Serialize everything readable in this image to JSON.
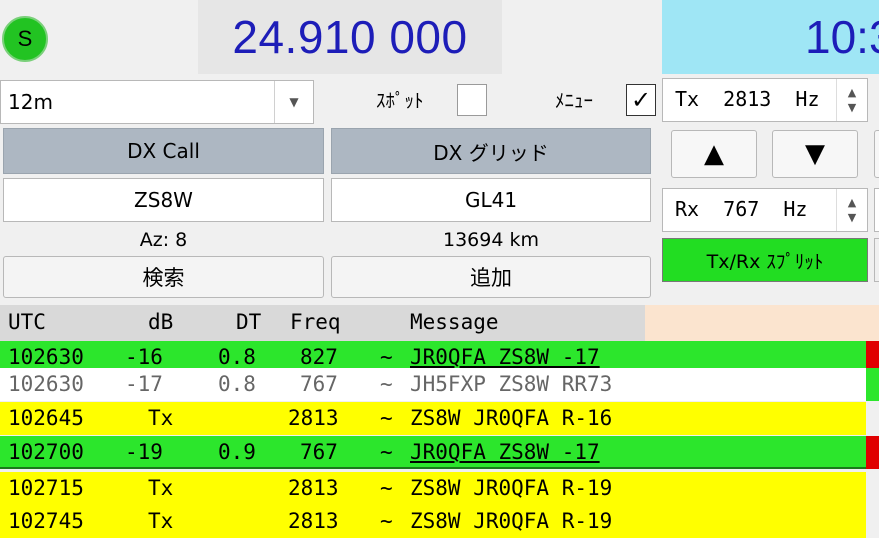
{
  "status_led": {
    "label": "S",
    "color": "#22c322"
  },
  "frequency": "24.910 000",
  "clock": "10:3",
  "band": {
    "value": "12m"
  },
  "spot": {
    "label": "ｽﾎﾟｯﾄ",
    "checked": false
  },
  "menu": {
    "label": "ﾒﾆｭｰ",
    "checked": true,
    "check_glyph": "✓"
  },
  "tx": {
    "text": "Tx  2813  Hz"
  },
  "rx": {
    "text": "Rx  767  Hz"
  },
  "arrows": {
    "up": "▲",
    "down": "▼",
    "spin_up": "▲",
    "spin_down": "▼",
    "combo": "▼"
  },
  "split_button": {
    "label": "Tx/Rx ｽﾌﾟﾘｯﾄ",
    "color": "#22dd22"
  },
  "dx": {
    "call_header": "DX Call",
    "grid_header": "DX グリッド",
    "call_value": "ZS8W",
    "grid_value": "GL41",
    "azimuth": "Az: 8",
    "distance": "13694 km",
    "search_button": "検索",
    "add_button": "追加"
  },
  "decode_columns": {
    "utc": "UTC",
    "db": "dB",
    "dt": "DT",
    "freq": "Freq",
    "message": "Message"
  },
  "decodes": [
    {
      "utc": "102630",
      "db": "-16",
      "dt": "0.8",
      "freq": "827",
      "sep": "~",
      "message": "JR0QFA ZS8W -17",
      "style": "green"
    },
    {
      "utc": "102630",
      "db": "-17",
      "dt": "0.8",
      "freq": "767",
      "sep": "~",
      "message": "JH5FXP ZS8W RR73",
      "style": "white"
    },
    {
      "utc": "102645",
      "db": "Tx",
      "dt": "",
      "freq": "2813",
      "sep": "~",
      "message": "ZS8W JR0QFA R-16",
      "style": "yellow"
    },
    {
      "utc": "102700",
      "db": "-19",
      "dt": "0.9",
      "freq": "767",
      "sep": "~",
      "message": "JR0QFA ZS8W -17",
      "style": "green"
    },
    {
      "utc": "102715",
      "db": "Tx",
      "dt": "",
      "freq": "2813",
      "sep": "~",
      "message": "ZS8W JR0QFA R-19",
      "style": "yellow"
    },
    {
      "utc": "102745",
      "db": "Tx",
      "dt": "",
      "freq": "2813",
      "sep": "~",
      "message": "ZS8W JR0QFA R-19",
      "style": "yellow"
    }
  ],
  "colors": {
    "freq_text": "#1d1db8",
    "clock_bg": "#9fe6f5",
    "green_row": "#2ce62c",
    "tx_row": "#ffff00",
    "header_peach": "#fbe4cf",
    "mark_red": "#e00000"
  }
}
